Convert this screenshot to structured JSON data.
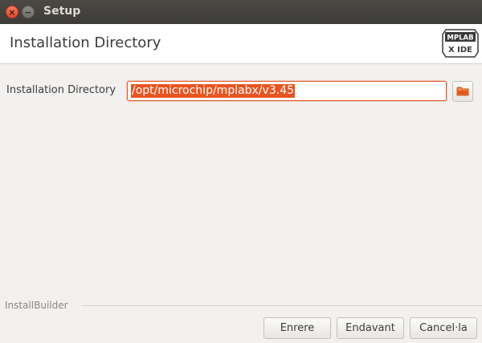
{
  "window": {
    "title": "Setup",
    "close_glyph": "×",
    "minimize_glyph": "−"
  },
  "header": {
    "title": "Installation Directory",
    "logo": {
      "top_text": "MPLAB",
      "bottom_text": "X IDE",
      "icon": "mplab-x-ide-logo"
    }
  },
  "form": {
    "directory_label": "Installation Directory",
    "directory_value": "/opt/microchip/mplabx/v3.45",
    "browse_icon": "folder-icon"
  },
  "footer": {
    "branding": "InstallBuilder",
    "back_label": "Enrere",
    "next_label": "Endavant",
    "cancel_label": "Cancel·la"
  },
  "colors": {
    "accent": "#e95420",
    "close_button": "#f0613e",
    "titlebar": "#3c3b37"
  }
}
